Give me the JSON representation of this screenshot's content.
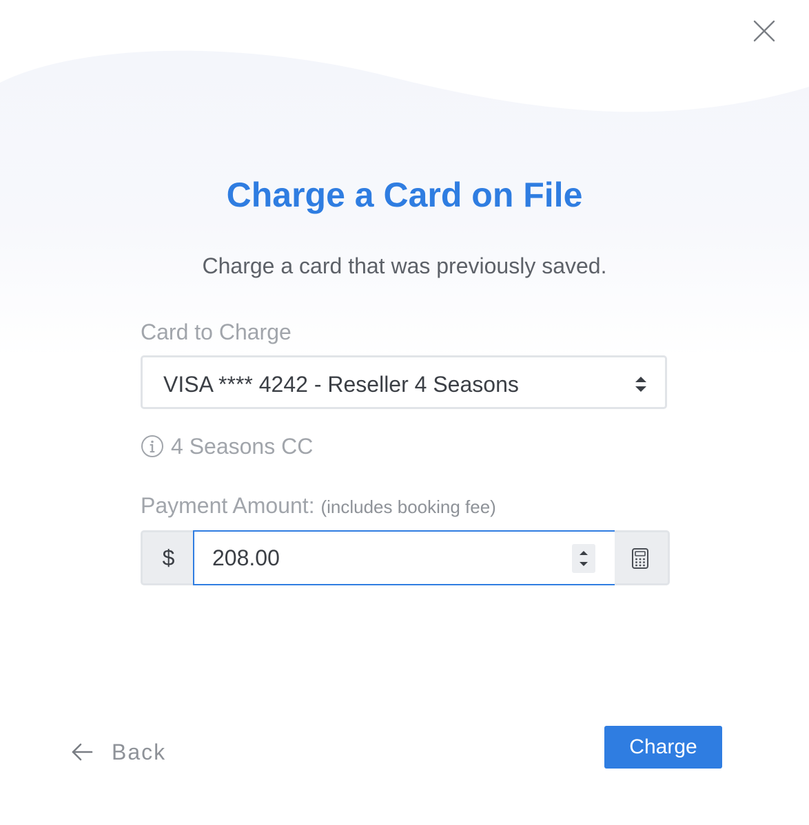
{
  "modal": {
    "title": "Charge a Card on File",
    "subtitle": "Charge a card that was previously saved."
  },
  "card_field": {
    "label": "Card to Charge",
    "selected": "VISA **** 4242 - Reseller 4 Seasons",
    "hint": "4 Seasons CC"
  },
  "amount_field": {
    "label": "Payment Amount:",
    "label_note": "(includes booking fee)",
    "currency_symbol": "$",
    "value": "208.00"
  },
  "footer": {
    "back_label": "Back",
    "charge_label": "Charge"
  },
  "icons": {
    "close": "close-icon",
    "select_arrows": "sort-arrows-icon",
    "info": "info-icon",
    "spinner": "stepper-arrows-icon",
    "calculator": "calculator-icon",
    "back": "arrow-left-icon"
  },
  "colors": {
    "accent": "#2f7de1",
    "muted_text": "#a1a5ab",
    "body_text": "#3b3f45",
    "addon_bg": "#ebedf0",
    "border": "#e1e4e8"
  }
}
